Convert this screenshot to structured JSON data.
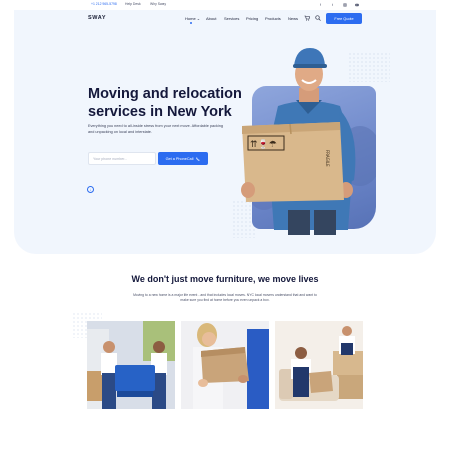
{
  "topbar": {
    "phone": "+1 212 965-5798",
    "help_desk": "Help Desk",
    "why_sway": "Why Sway",
    "social": [
      "facebook-icon",
      "twitter-icon",
      "instagram-icon",
      "youtube-icon"
    ]
  },
  "header": {
    "logo": "SWAY",
    "nav": {
      "home": "Home ⌄",
      "about": "About",
      "services": "Services",
      "pricing": "Pricing",
      "products": "Products",
      "news": "News"
    },
    "cart_icon": "cart-icon",
    "search_icon": "search-icon",
    "quote_button": "Free Quote"
  },
  "hero": {
    "headline": "Moving and relocation services in New York",
    "subtext": "Everything you need to all-inside stress from your next move. Affordable packing and unpacking on local and interstate.",
    "phone_placeholder": "Your phone number...",
    "call_button": "Get a PhoneCall"
  },
  "section": {
    "title": "We don't just move furniture, we move lives",
    "text": "Moving to a new home is a major life event - and that includes local moves. NYC local movers understand that and want to make sure you find at home before you even unpack a box."
  },
  "colors": {
    "accent": "#2c6cf0",
    "hero_bg": "#f1f6fd",
    "heading": "#14183b"
  }
}
